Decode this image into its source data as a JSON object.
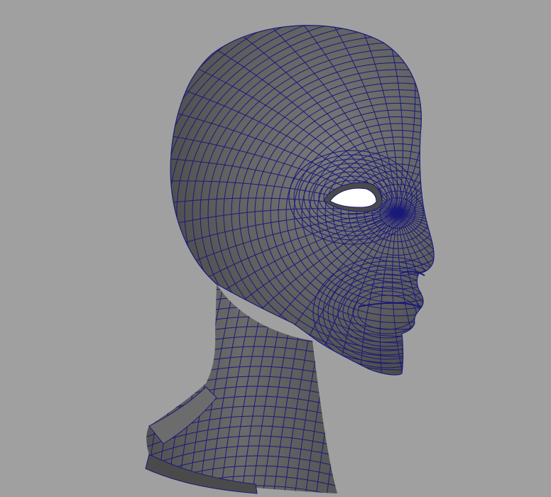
{
  "viewport": {
    "background_color": "#a0a0a0",
    "object": "polygon-head-mesh",
    "display_mode": "wireframe-on-shaded",
    "shade_color": "#5f5f5f",
    "wireframe_color": "#1a1a7a",
    "eye_hole_color": "#ffffff"
  }
}
